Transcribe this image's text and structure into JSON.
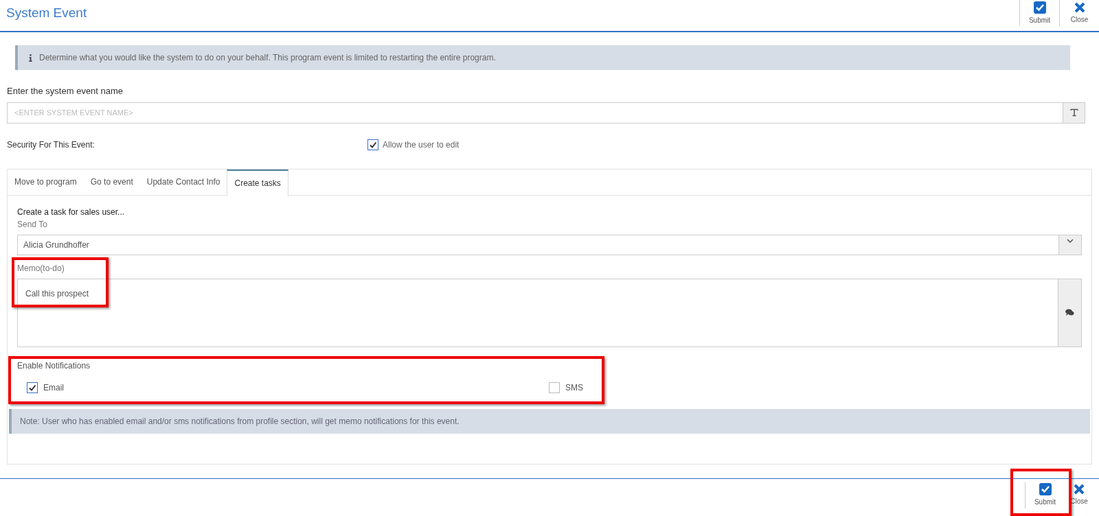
{
  "window": {
    "title": "System Event"
  },
  "toolbar": [
    {
      "kind": "submit",
      "label": "Submit"
    },
    {
      "kind": "close",
      "label": "Close"
    }
  ],
  "info_banner": "Determine what you would like the system to do on your behalf. This program event is limited to restarting the entire program.",
  "event_name": {
    "label": "Enter the system event name",
    "placeholder": "<ENTER SYSTEM EVENT NAME>"
  },
  "security": {
    "label": "Security For This Event:",
    "option": {
      "label": "Allow the user to edit",
      "checked": true
    }
  },
  "tabs": [
    {
      "label": "Move to program",
      "selected": false
    },
    {
      "label": "Go to event",
      "selected": false
    },
    {
      "label": "Update Contact Info",
      "selected": false
    },
    {
      "label": "Create tasks",
      "selected": true
    }
  ],
  "task": {
    "heading": "Create a task for sales user...",
    "send_to": {
      "label": "Send To",
      "value": "Alicia Grundhoffer"
    },
    "memo": {
      "label": "Memo(to-do)",
      "value": "Call this prospect"
    },
    "notifications": {
      "label": "Enable Notifications",
      "options": [
        {
          "label": "Email",
          "checked": true
        },
        {
          "label": "SMS",
          "checked": false
        }
      ]
    },
    "note": "Note: User who has enabled email and/or sms notifications from profile section, will get memo notifications for this event."
  },
  "footer": [
    {
      "kind": "submit",
      "label": "Submit"
    },
    {
      "kind": "close",
      "label": "Close"
    }
  ]
}
